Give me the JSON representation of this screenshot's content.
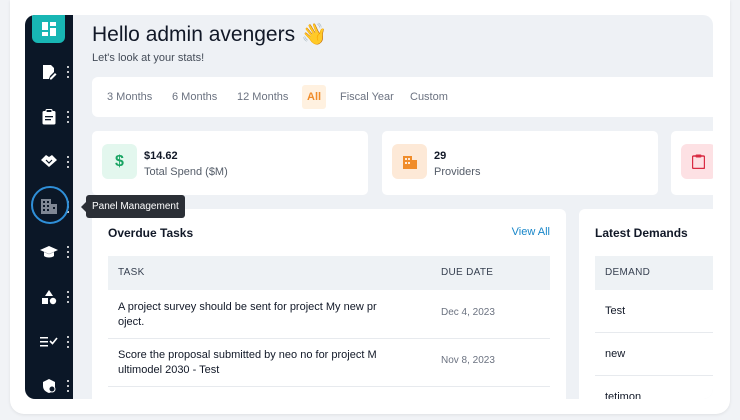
{
  "sidebar": {
    "tooltip": "Panel Management",
    "items": [
      {
        "icon": "document-edit-icon"
      },
      {
        "icon": "clipboard-icon"
      },
      {
        "icon": "handshake-icon"
      },
      {
        "icon": "building-icon"
      },
      {
        "icon": "graduation-cap-icon"
      },
      {
        "icon": "shapes-icon"
      },
      {
        "icon": "checklist-icon"
      },
      {
        "icon": "shield-home-icon"
      }
    ]
  },
  "header": {
    "greeting": "Hello admin avengers 👋",
    "subtitle": "Let's look at your stats!"
  },
  "filters": {
    "tabs": [
      "3 Months",
      "6 Months",
      "12 Months",
      "All",
      "Fiscal Year",
      "Custom"
    ],
    "active": "All",
    "accent_color": "#f08c2a"
  },
  "stats": [
    {
      "value": "$14.62",
      "label": "Total Spend ($M)",
      "icon": "dollar-icon",
      "color": "#e3f7ee",
      "icon_color": "#19a463"
    },
    {
      "value": "29",
      "label": "Providers",
      "icon": "building-icon",
      "color": "#fde9d7",
      "icon_color": "#f08c2a"
    },
    {
      "value": "",
      "label": "",
      "icon": "clipboard-icon",
      "color": "#fde1e4",
      "icon_color": "#d92c43"
    }
  ],
  "overdue": {
    "title": "Overdue Tasks",
    "view_all": "View All",
    "columns": [
      "TASK",
      "DUE DATE"
    ],
    "rows": [
      {
        "task": "A project survey should be sent for project My new pr oject.",
        "due": "Dec 4, 2023"
      },
      {
        "task": "Score the proposal submitted by neo no for project M ultimodel 2030 - Test",
        "due": "Nov 8, 2023"
      }
    ]
  },
  "demands": {
    "title": "Latest Demands",
    "columns": [
      "DEMAND"
    ],
    "rows": [
      "Test",
      "new",
      "tetimon"
    ]
  }
}
